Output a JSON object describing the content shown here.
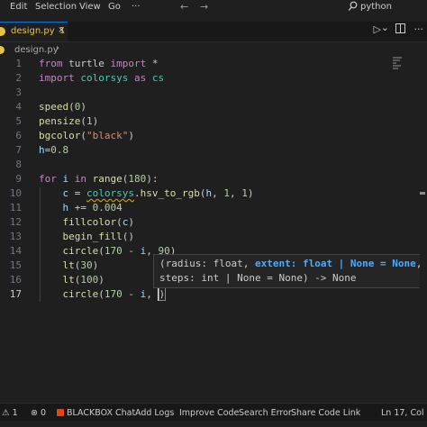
{
  "menu": [
    "Edit",
    "Selection",
    "View",
    "Go",
    "···"
  ],
  "nav": {
    "back": "←",
    "forward": "→"
  },
  "search": {
    "icon": "search-icon",
    "text": "python"
  },
  "tab": {
    "label": "design.py",
    "modified_num": "1",
    "close": "×"
  },
  "tab_actions": {
    "run": "▷",
    "run_menu": "⌄",
    "split": "▯",
    "more": "···"
  },
  "breadcrumb": {
    "file": "design.py",
    "sep": "›"
  },
  "editor": {
    "line_numbers": [
      "1",
      "2",
      "3",
      "4",
      "5",
      "6",
      "7",
      "8",
      "9",
      "10",
      "11",
      "12",
      "13",
      "14",
      "15",
      "16",
      "17"
    ],
    "active_line": "17"
  },
  "tooltip": {
    "row1_a": "(radius: float, ",
    "row1_hl": "extent: float | None = None",
    "row1_b": ",",
    "row2": "steps: int | None = None) -> None"
  },
  "status": {
    "warnings_count": "1",
    "errors_count": "0",
    "blackbox": "BLACKBOX Chat",
    "add_logs": "Add Logs",
    "improve": "Improve Code",
    "search_error": "Search Error",
    "share": "Share Code Link",
    "position": "Ln 17, Col"
  },
  "colors": {
    "accent": "#0078d4",
    "keyword": "#c586c0",
    "control": "#569cd6",
    "function": "#dcdcaa",
    "number": "#b5cea8",
    "string": "#ce9178",
    "module": "#4ec9b0"
  }
}
